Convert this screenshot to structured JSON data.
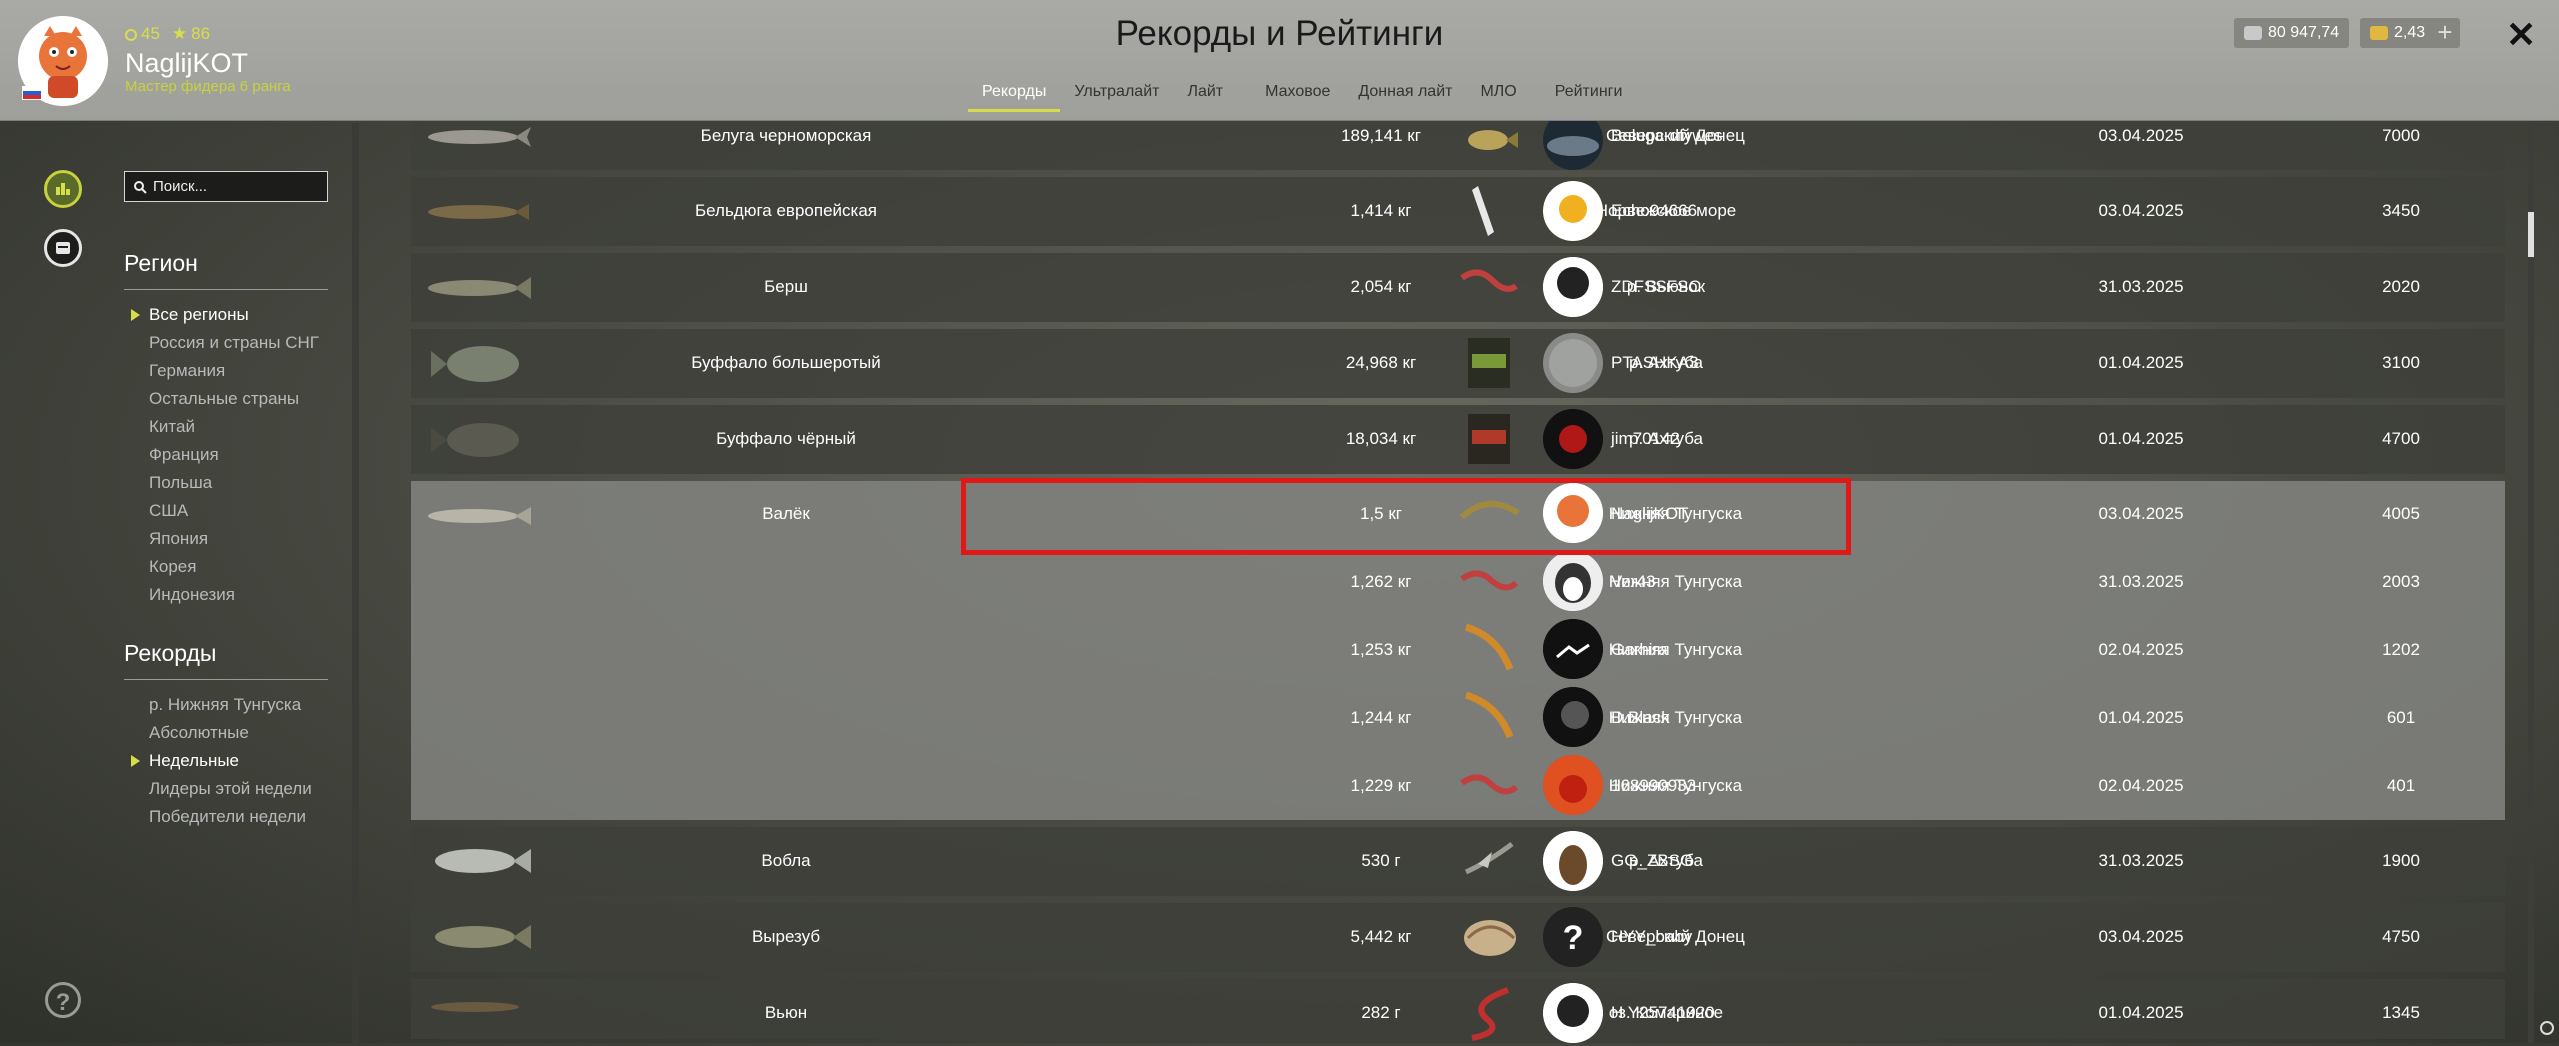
{
  "header": {
    "title": "Рекорды и Рейтинги",
    "coins": "45",
    "stars": "86",
    "username": "NaglijKOT",
    "rank": "Мастер фидера 6 ранга",
    "silver": "80 947,74",
    "gold": "2,43",
    "plus": "+",
    "close": "✕",
    "tabs": [
      "Рекорды",
      "Ультралайт",
      "Лайт",
      "Маховое",
      "Донная лайт",
      "МЛО",
      "Рейтинги"
    ]
  },
  "sidebar": {
    "search_placeholder": "Поиск...",
    "region_heading": "Регион",
    "regions": [
      "Все регионы",
      "Россия и страны СНГ",
      "Германия",
      "Остальные страны",
      "Китай",
      "Франция",
      "Польша",
      "США",
      "Япония",
      "Корея",
      "Индонезия"
    ],
    "records_heading": "Рекорды",
    "records": [
      "р. Нижняя Тунгуска",
      "Абсолютные",
      "Недельные",
      "Лидеры этой недели",
      "Победители недели"
    ],
    "help": "?"
  },
  "rows": [
    {
      "fish": "Белуга черноморская",
      "weight": "189,141 кг",
      "location": "р. Северский Донец",
      "user": "Beluga-dfywes",
      "date": "03.04.2025",
      "points": "7000"
    },
    {
      "fish": "Бельдюга европейская",
      "weight": "1,414 кг",
      "location": "Норвежское море",
      "user": "Echo94666",
      "date": "03.04.2025",
      "points": "3450"
    },
    {
      "fish": "Берш",
      "weight": "2,054 кг",
      "location": "р. Вьюнок",
      "user": "ZDFSSFSC",
      "date": "31.03.2025",
      "points": "2020"
    },
    {
      "fish": "Буффало большеротый",
      "weight": "24,968 кг",
      "location": "р. Ахтуба",
      "user": "PTASHKA3",
      "date": "01.04.2025",
      "points": "3100"
    },
    {
      "fish": "Буффало чёрный",
      "weight": "18,034 кг",
      "location": "р. Ахтуба",
      "user": "jim70142",
      "date": "01.04.2025",
      "points": "4700"
    }
  ],
  "group": {
    "fish": "Валёк",
    "entries": [
      {
        "weight": "1,5 кг",
        "location": "р. Нижняя Тунгуска",
        "user": "NaglijKOT",
        "date": "03.04.2025",
        "points": "4005"
      },
      {
        "weight": "1,262 кг",
        "location": "р. Нижняя Тунгуска",
        "user": "Ver43",
        "date": "31.03.2025",
        "points": "2003"
      },
      {
        "weight": "1,253 кг",
        "location": "р. Нижняя Тунгуска",
        "user": "Garhira",
        "date": "02.04.2025",
        "points": "1202"
      },
      {
        "weight": "1,244 кг",
        "location": "р. Нижняя Тунгуска",
        "user": "D.Black",
        "date": "01.04.2025",
        "points": "601"
      },
      {
        "weight": "1,229 кг",
        "location": "р. Нижняя Тунгуска",
        "user": "168990933",
        "date": "02.04.2025",
        "points": "401"
      }
    ]
  },
  "rows2": [
    {
      "fish": "Вобла",
      "weight": "530 г",
      "location": "р. Ахтуба",
      "user": "GG_ZBSG",
      "date": "31.03.2025",
      "points": "1900"
    },
    {
      "fish": "Вырезуб",
      "weight": "5,442 кг",
      "location": "р. Северский Донец",
      "user": "HYY_baby",
      "date": "03.04.2025",
      "points": "4750"
    },
    {
      "fish": "Вьюн",
      "weight": "282 г",
      "location": "оз. Комариное",
      "user": "H Y25741920",
      "date": "01.04.2025",
      "points": "1345"
    }
  ],
  "colors": {
    "accent": "#d8de4a",
    "highlight": "#e11818"
  }
}
